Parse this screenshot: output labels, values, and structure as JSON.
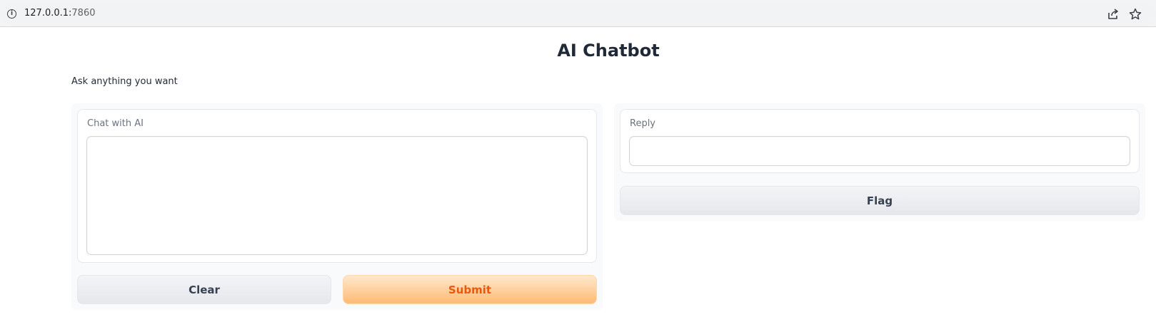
{
  "browser": {
    "url_host": "127.0.0.1:",
    "url_port": "7860",
    "info_icon": "info-icon",
    "share_icon": "share-icon",
    "bookmark_icon": "star-icon"
  },
  "app": {
    "title": "AI Chatbot",
    "description": "Ask anything you want"
  },
  "input_panel": {
    "label": "Chat with AI",
    "value": "",
    "clear_label": "Clear",
    "submit_label": "Submit"
  },
  "output_panel": {
    "label": "Reply",
    "value": "",
    "flag_label": "Flag"
  },
  "colors": {
    "primary_text": "#ea580c",
    "primary_gradient_start": "#ffe8cc",
    "primary_gradient_end": "#fdba74",
    "panel_bg": "#f9fafb"
  }
}
